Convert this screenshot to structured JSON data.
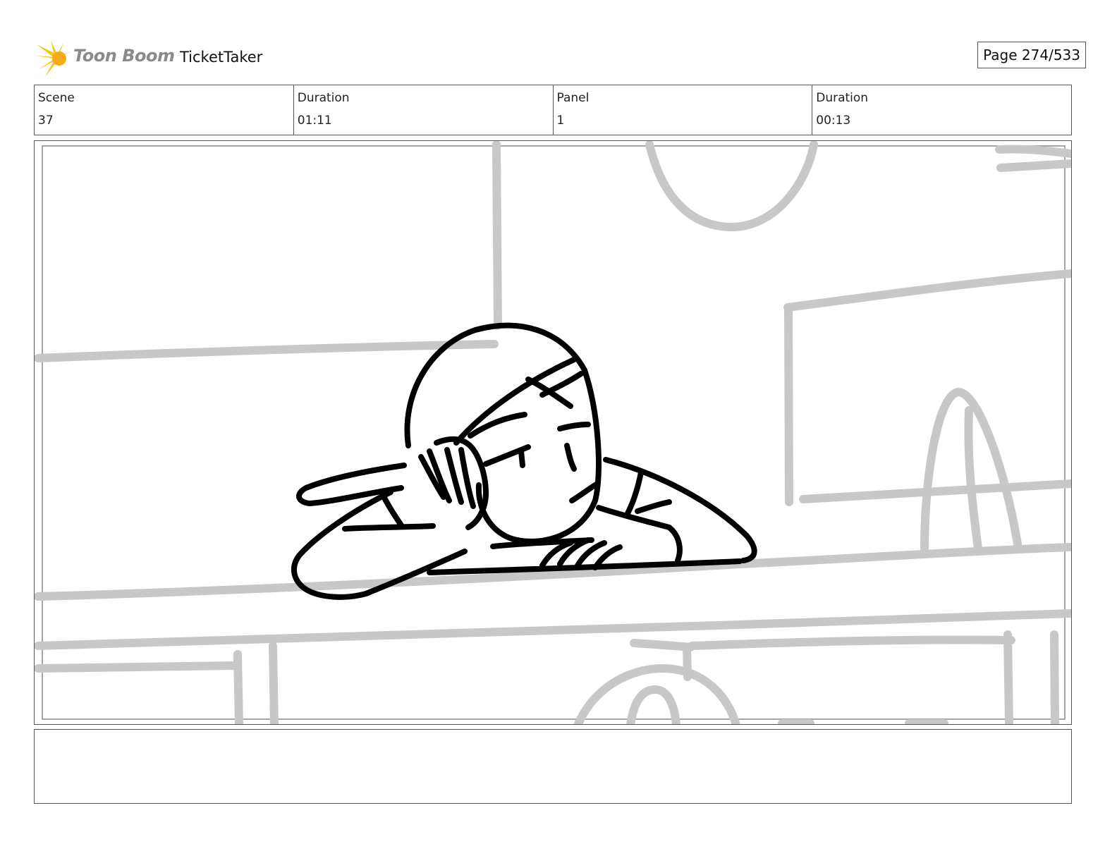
{
  "header": {
    "logo_text": "Toon Boom",
    "project_title": "TicketTaker",
    "page_label": "Page 274/533"
  },
  "info": [
    {
      "label": "Scene",
      "value": "37"
    },
    {
      "label": "Duration",
      "value": "01:11"
    },
    {
      "label": "Panel",
      "value": "1"
    },
    {
      "label": "Duration",
      "value": "00:13"
    }
  ],
  "panel": {
    "description": "",
    "line_color": "#000000",
    "background_line_color": "#c8c8c8"
  },
  "notes": {
    "text": ""
  }
}
